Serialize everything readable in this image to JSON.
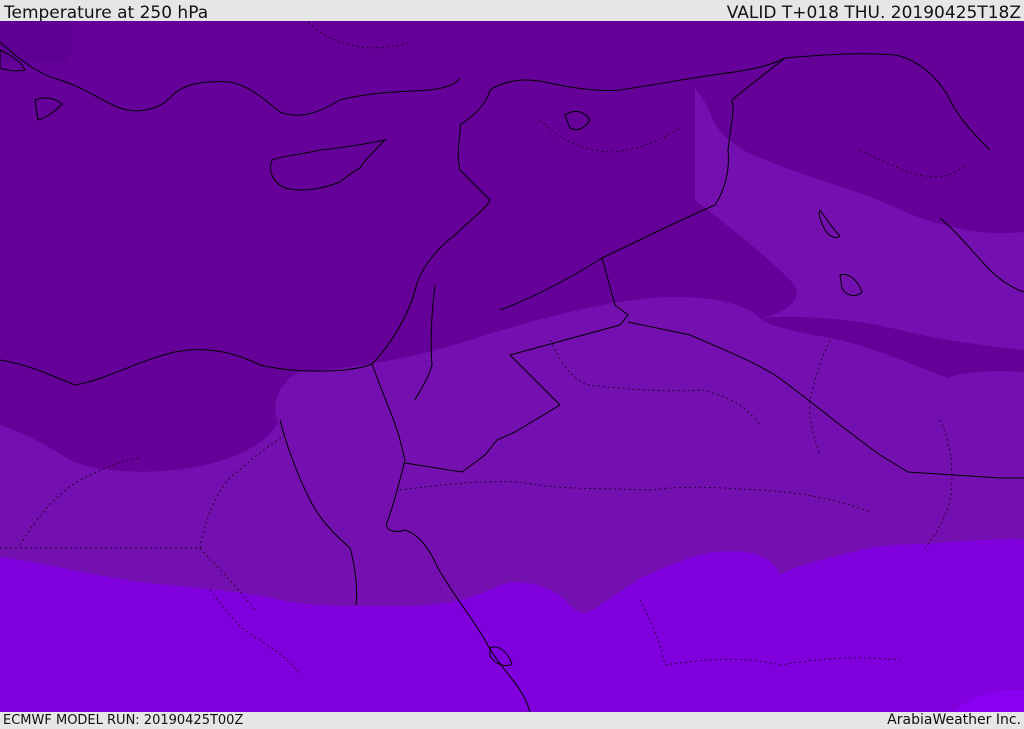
{
  "header": {
    "title": "Temperature at 250 hPa",
    "valid_time": "VALID T+018 THU. 20190425T18Z"
  },
  "footer": {
    "model_run": "ECMWF MODEL RUN: 20190425T00Z",
    "credit": "ArabiaWeather Inc."
  },
  "map": {
    "field": "temperature",
    "level": "250 hPa",
    "colors": {
      "coldest_band": "#5e0094",
      "band_2": "#650099",
      "band_3": "#7410af",
      "band_4": "#7f00dd",
      "band_5": "#8a00f0",
      "coastline": "#000000",
      "borders": "#000000"
    }
  }
}
